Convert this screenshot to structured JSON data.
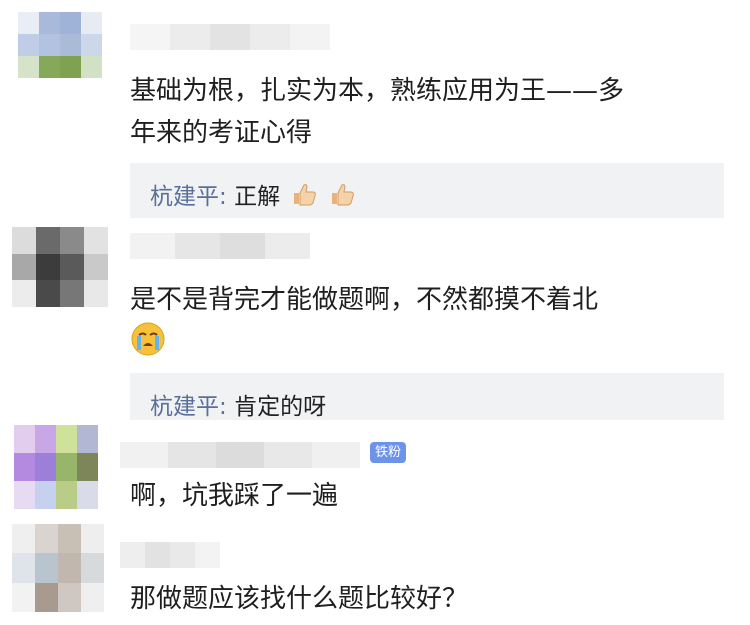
{
  "comments": [
    {
      "text_lines": [
        "基础为根，扎实为本，熟练应用为王——多",
        "年来的考证心得"
      ],
      "reply": {
        "author": "杭建平",
        "separator": ": ",
        "text": "正解",
        "icons": [
          "thumbs-up-icon",
          "thumbs-up-icon"
        ]
      }
    },
    {
      "text": "是不是背完才能做题啊，不然都摸不着北",
      "emoji": "crying-face-icon",
      "reply": {
        "author": "杭建平",
        "separator": ": ",
        "text": "肯定的呀"
      }
    },
    {
      "badge": "铁粉",
      "text": "啊，坑我踩了一遍"
    },
    {
      "text": "那做题应该找什么题比较好？"
    }
  ],
  "colors": {
    "reply_author": "#5a6f9a",
    "reply_bg": "#f1f2f3",
    "badge": "#6d93e8"
  }
}
